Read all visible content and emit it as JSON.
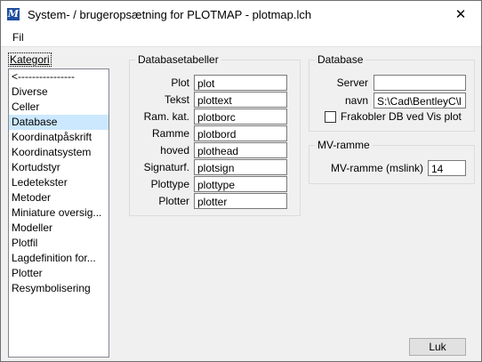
{
  "window": {
    "title": "System- / brugeropsætning for PLOTMAP - plotmap.lch",
    "close_glyph": "✕",
    "app_icon_glyph": "M"
  },
  "menu": {
    "file": "Fil"
  },
  "category": {
    "label": "Kategori",
    "items": [
      "<----------------",
      "Diverse",
      "Celler",
      "Database",
      "Koordinatpåskrift",
      "Koordinatsystem",
      "Kortudstyr",
      "Ledetekster",
      "Metoder",
      "Miniature oversig...",
      "Modeller",
      "Plotfil",
      "Lagdefinition for...",
      "Plotter",
      "Resymbolisering"
    ],
    "selected": "Database"
  },
  "db_tables": {
    "title": "Databasetabeller",
    "rows": [
      {
        "label": "Plot",
        "value": "plot"
      },
      {
        "label": "Tekst",
        "value": "plottext"
      },
      {
        "label": "Ram. kat.",
        "value": "plotborc"
      },
      {
        "label": "Ramme",
        "value": "plotbord"
      },
      {
        "label": "hoved",
        "value": "plothead"
      },
      {
        "label": "Signaturf.",
        "value": "plotsign"
      },
      {
        "label": "Plottype",
        "value": "plottype"
      },
      {
        "label": "Plotter",
        "value": "plotter"
      }
    ]
  },
  "database": {
    "title": "Database",
    "server_label": "Server",
    "server_value": "",
    "navn_label": "navn",
    "navn_value": "S:\\Cad\\BentleyC\\l",
    "checkbox_label": "Frakobler DB ved Vis plot",
    "checkbox_checked": false
  },
  "mv_ramme": {
    "title": "MV-ramme",
    "label": "MV-ramme (mslink)",
    "value": "14"
  },
  "buttons": {
    "ok": "Luk"
  }
}
